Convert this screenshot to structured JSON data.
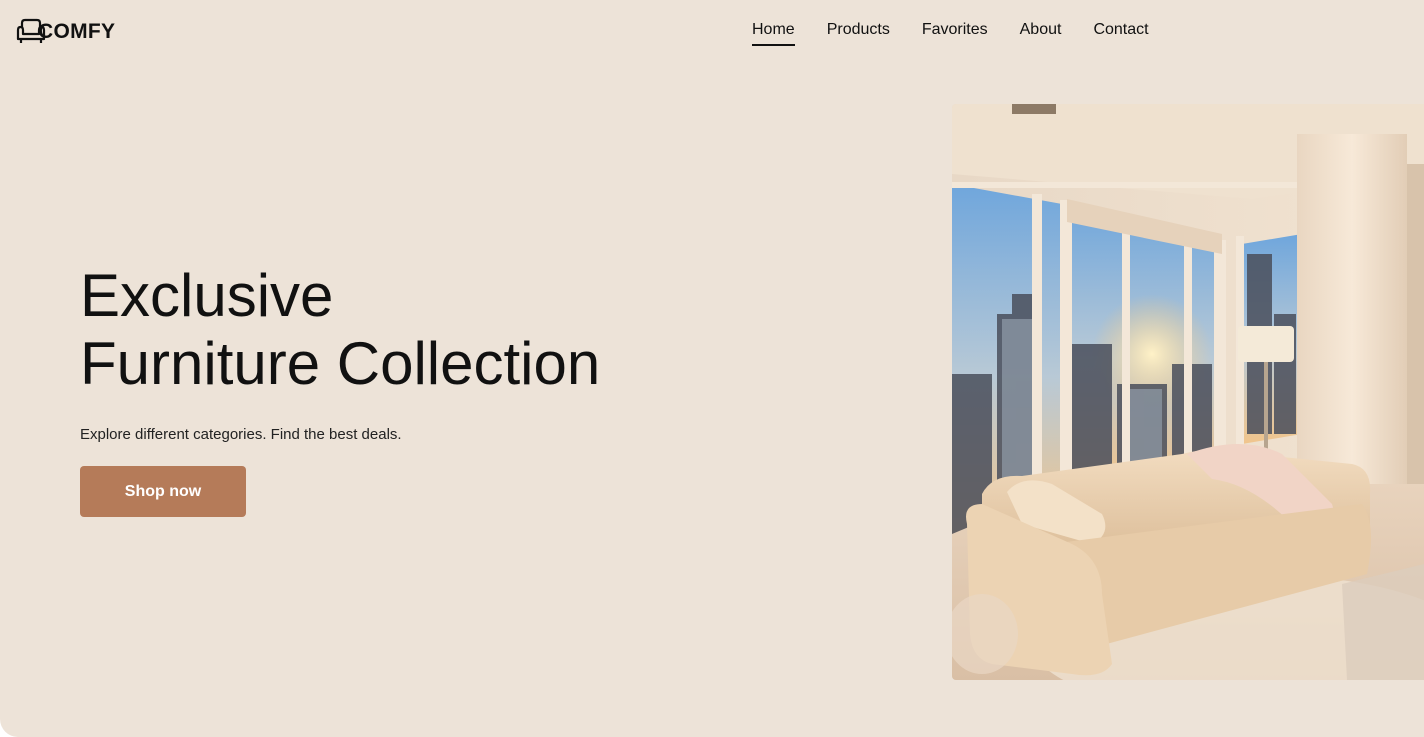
{
  "brand": {
    "name": "COMFY",
    "icon": "sofa-icon"
  },
  "nav": {
    "items": [
      {
        "label": "Home",
        "active": true
      },
      {
        "label": "Products",
        "active": false
      },
      {
        "label": "Favorites",
        "active": false
      },
      {
        "label": "About",
        "active": false
      },
      {
        "label": "Contact",
        "active": false
      }
    ]
  },
  "hero": {
    "title_line1": "Exclusive",
    "title_line2": "Furniture Collection",
    "subtitle": "Explore different categories. Find the best deals.",
    "cta_label": "Shop now"
  },
  "colors": {
    "background": "#ede3d8",
    "accent": "#b57b59",
    "text": "#111111"
  }
}
